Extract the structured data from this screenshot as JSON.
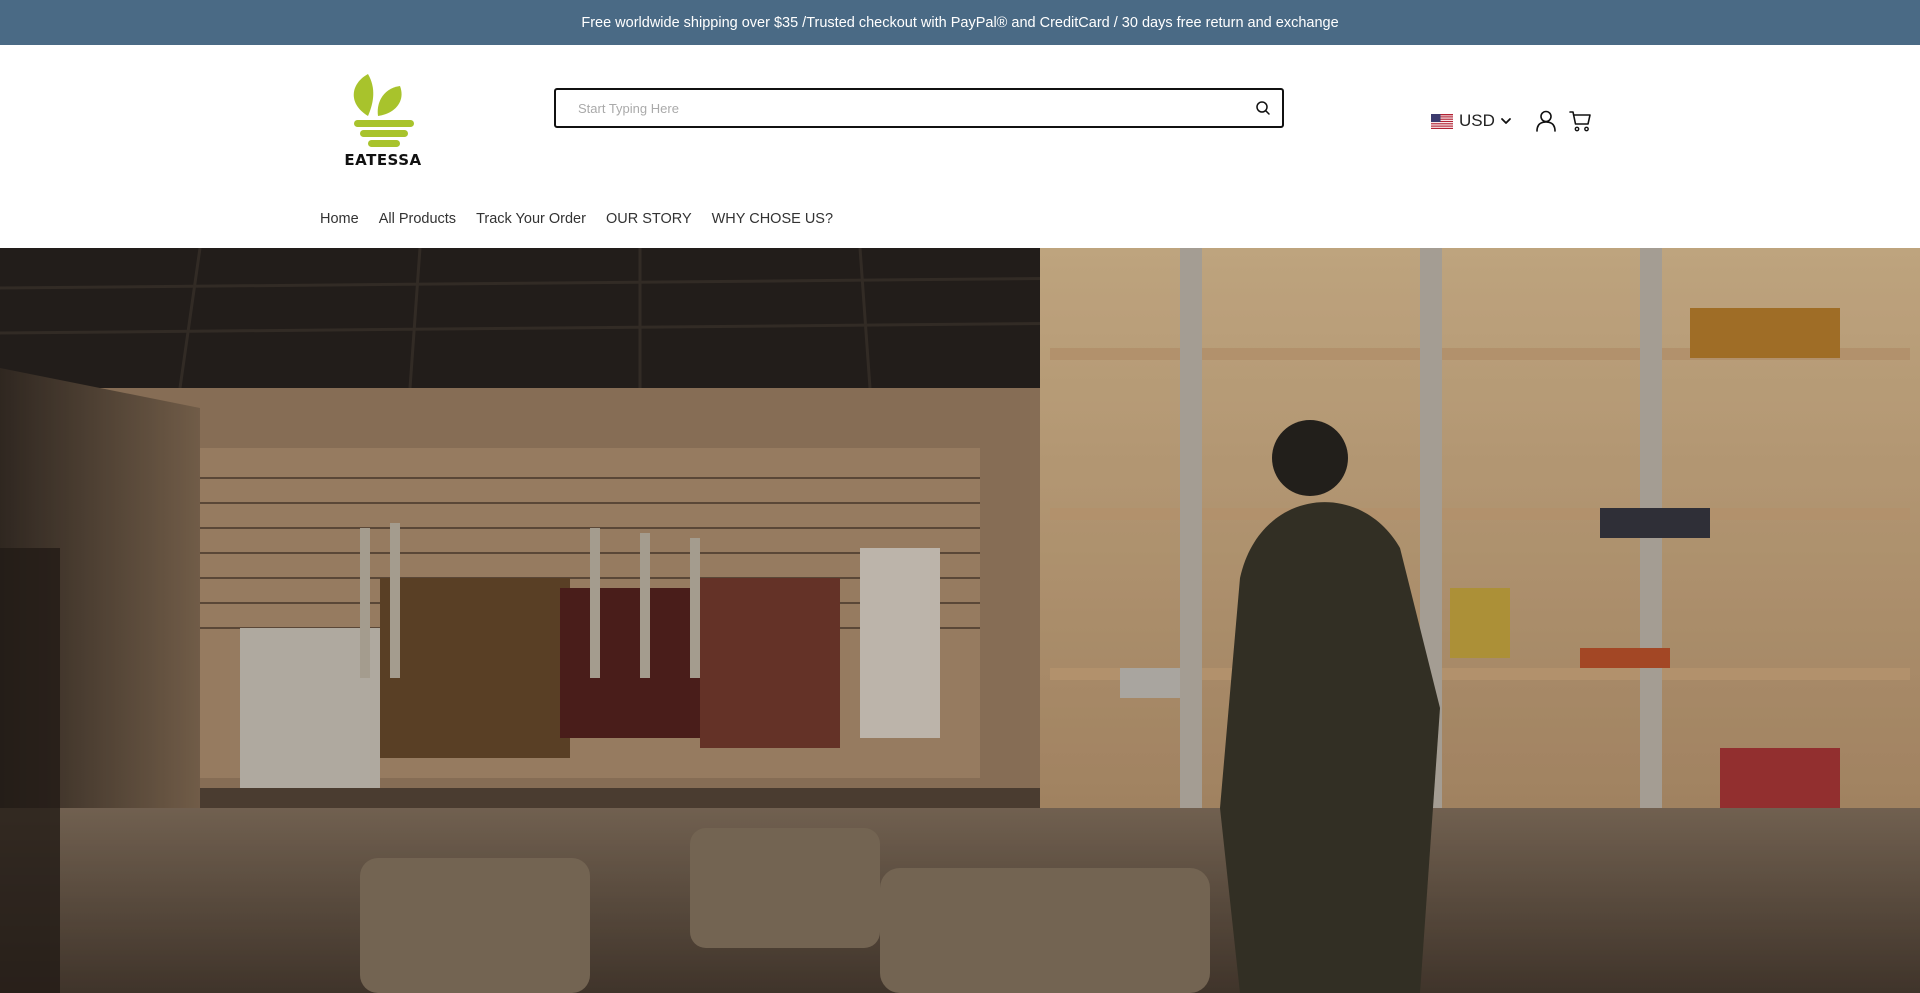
{
  "announcement": {
    "text": "Free worldwide shipping over $35 /Trusted checkout with PayPal® and CreditCard / 30 days free return and exchange"
  },
  "brand": {
    "name": "EATESSA",
    "logo_color": "#a8c32c"
  },
  "search": {
    "placeholder": "Start Typing Here",
    "value": "",
    "icon": "search-icon"
  },
  "currency": {
    "code": "USD",
    "flag": "us-flag-icon"
  },
  "header_icons": {
    "account": "user-icon",
    "cart": "cart-icon"
  },
  "nav": {
    "items": [
      {
        "label": "Home"
      },
      {
        "label": "All Products"
      },
      {
        "label": "Track Your Order"
      },
      {
        "label": "OUR STORY"
      },
      {
        "label": "WHY CHOSE US?"
      }
    ]
  },
  "colors": {
    "announcement_bg": "#4a6a85",
    "announcement_text": "#ffffff",
    "accent": "#a8c32c"
  },
  "hero": {
    "image": "photo of a clothing store interior with jackets on racks, skis, shelves with folded clothes and armchairs"
  }
}
